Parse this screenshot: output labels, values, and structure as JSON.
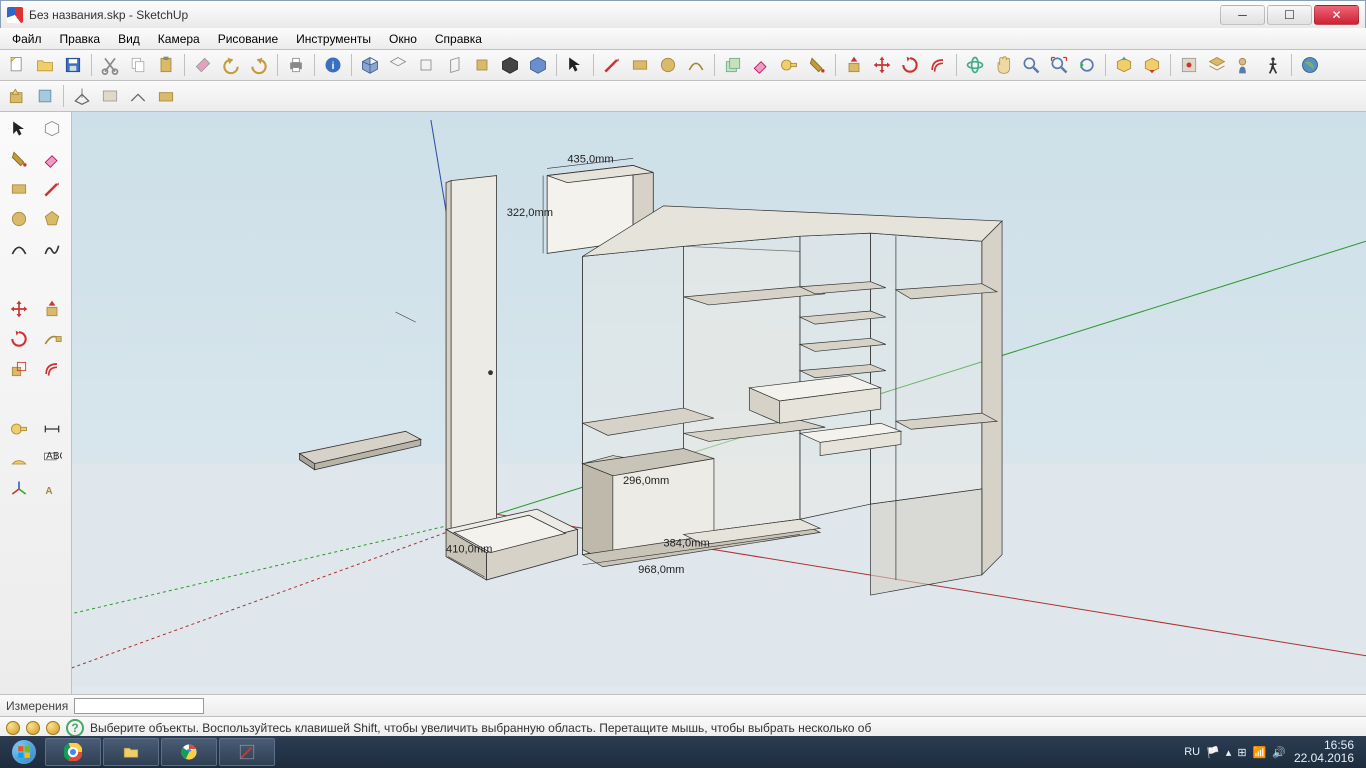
{
  "window": {
    "title": "Без названия.skp - SketchUp",
    "controls": {
      "min": "─",
      "max": "☐",
      "close": "✕"
    }
  },
  "menu": {
    "file": "Файл",
    "edit": "Правка",
    "view": "Вид",
    "camera": "Камера",
    "draw": "Рисование",
    "tools": "Инструменты",
    "window": "Окно",
    "help": "Справка"
  },
  "measurements": {
    "label": "Измерения",
    "value": ""
  },
  "status": {
    "help_icon": "?",
    "message": "Выберите объекты. Воспользуйтесь клавишей Shift, чтобы увеличить выбранную область. Перетащите мышь, чтобы выбрать несколько об"
  },
  "dimensions": {
    "d1": "435,0mm",
    "d2": "322,0mm",
    "d3": "296,0mm",
    "d4": "384,0mm",
    "d5": "410,0mm",
    "d6": "968,0mm"
  },
  "taskbar": {
    "lang": "RU",
    "time": "16:56",
    "date": "22.04.2016"
  },
  "icons": {
    "select": "select",
    "eraser": "eraser",
    "paint": "paint",
    "rect": "rect",
    "line": "line",
    "circle": "circle",
    "arc": "arc",
    "pushpull": "pushpull",
    "move": "move",
    "rotate": "rotate",
    "offset": "offset",
    "tape": "tape",
    "protractor": "protractor",
    "text": "text",
    "axes": "axes",
    "walk": "walk"
  }
}
